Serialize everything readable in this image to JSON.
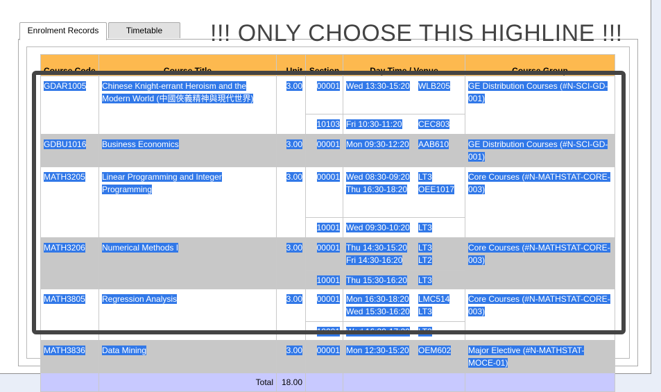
{
  "tabs": [
    "Enrolment Records",
    "Timetable"
  ],
  "banner": "!!! ONLY CHOOSE THIS HIGHLINE !!!",
  "table": {
    "headers": [
      "Course Code",
      "Course Title",
      "Unit",
      "Section",
      "Day Time / Venue",
      "Course Group"
    ],
    "courses": [
      {
        "code": "GDAR1005",
        "title": "Chinese Knight-errant Heroism and the Modern World (中國俠義精神與現代世界)",
        "unit": "3.00",
        "group": "GE Distribution Courses (#N-SCI-GD-001)",
        "sections": [
          {
            "section": "00001",
            "slots": [
              {
                "time": "Wed 13:30-15:20",
                "venue": "WLB205"
              }
            ]
          },
          {
            "section": "10103",
            "slots": [
              {
                "time": "Fri 10:30-11:20",
                "venue": "CEC803"
              }
            ]
          }
        ]
      },
      {
        "code": "GDBU1016",
        "title": "Business Economics",
        "unit": "3.00",
        "group": "GE Distribution Courses (#N-SCI-GD-001)",
        "sections": [
          {
            "section": "00001",
            "slots": [
              {
                "time": "Mon 09:30-12:20",
                "venue": "AAB610"
              }
            ]
          }
        ]
      },
      {
        "code": "MATH3205",
        "title": "Linear Programming and Integer Programming",
        "unit": "3.00",
        "group": "Core Courses (#N-MATHSTAT-CORE-003)",
        "sections": [
          {
            "section": "00001",
            "slots": [
              {
                "time": "Wed 08:30-09:20",
                "venue": "LT3"
              },
              {
                "time": "Thu 16:30-18:20",
                "venue": "OEE1017"
              }
            ]
          },
          {
            "section": "10001",
            "slots": [
              {
                "time": "Wed 09:30-10:20",
                "venue": "LT3"
              }
            ]
          }
        ]
      },
      {
        "code": "MATH3206",
        "title": "Numerical Methods I",
        "unit": "3.00",
        "group": "Core Courses (#N-MATHSTAT-CORE-003)",
        "sections": [
          {
            "section": "00001",
            "slots": [
              {
                "time": "Thu 14:30-15:20",
                "venue": "LT3"
              },
              {
                "time": "Fri 14:30-16:20",
                "venue": "LT2"
              }
            ]
          },
          {
            "section": "10001",
            "slots": [
              {
                "time": "Thu 15:30-16:20",
                "venue": "LT3"
              }
            ]
          }
        ]
      },
      {
        "code": "MATH3805",
        "title": "Regression Analysis",
        "unit": "3.00",
        "group": "Core Courses (#N-MATHSTAT-CORE-003)",
        "sections": [
          {
            "section": "00001",
            "slots": [
              {
                "time": "Mon 16:30-18:20",
                "venue": "LMC514"
              },
              {
                "time": "Wed 15:30-16:20",
                "venue": "LT3"
              }
            ]
          },
          {
            "section": "10001",
            "slots": [
              {
                "time": "Wed 16:30-17:20",
                "venue": "LT3"
              }
            ]
          }
        ]
      },
      {
        "code": "MATH3836",
        "title": "Data Mining",
        "unit": "3.00",
        "group": "Major Elective (#N-MATHSTAT-MOCE-01)",
        "sections": [
          {
            "section": "00001",
            "slots": [
              {
                "time": "Mon 12:30-15:20",
                "venue": "OEM602"
              }
            ]
          }
        ]
      }
    ],
    "total_label": "Total",
    "total_value": "18.00"
  },
  "colors": {
    "header_bg": "#fdb94f",
    "selection": "#3178e8",
    "row_grey": "#c8c8c8",
    "total_bg": "#c8c9ff"
  }
}
